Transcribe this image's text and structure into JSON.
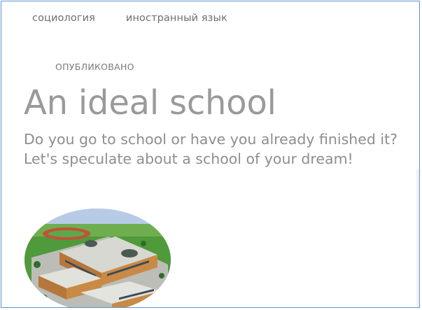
{
  "tags": {
    "sociology": "социология",
    "foreign_language": "иностранный язык"
  },
  "article": {
    "status": "ОПУБЛИКОВАНО",
    "title": "An ideal school",
    "description": "Do you go to school or have you already finished it? Let's speculate about a school of your dream!"
  },
  "cover_image": {
    "icon": "school-building-illustration",
    "colors": {
      "sky": "#9db8da",
      "grass": "#4f9a3a",
      "roof": "#d8d8d2",
      "walls": "#c98a45",
      "windows": "#3b4a59"
    }
  },
  "colors": {
    "border": "#5b93d1",
    "title": "#9a9a9a",
    "text": "#8e8e8e",
    "tag": "#6f6f6f"
  }
}
